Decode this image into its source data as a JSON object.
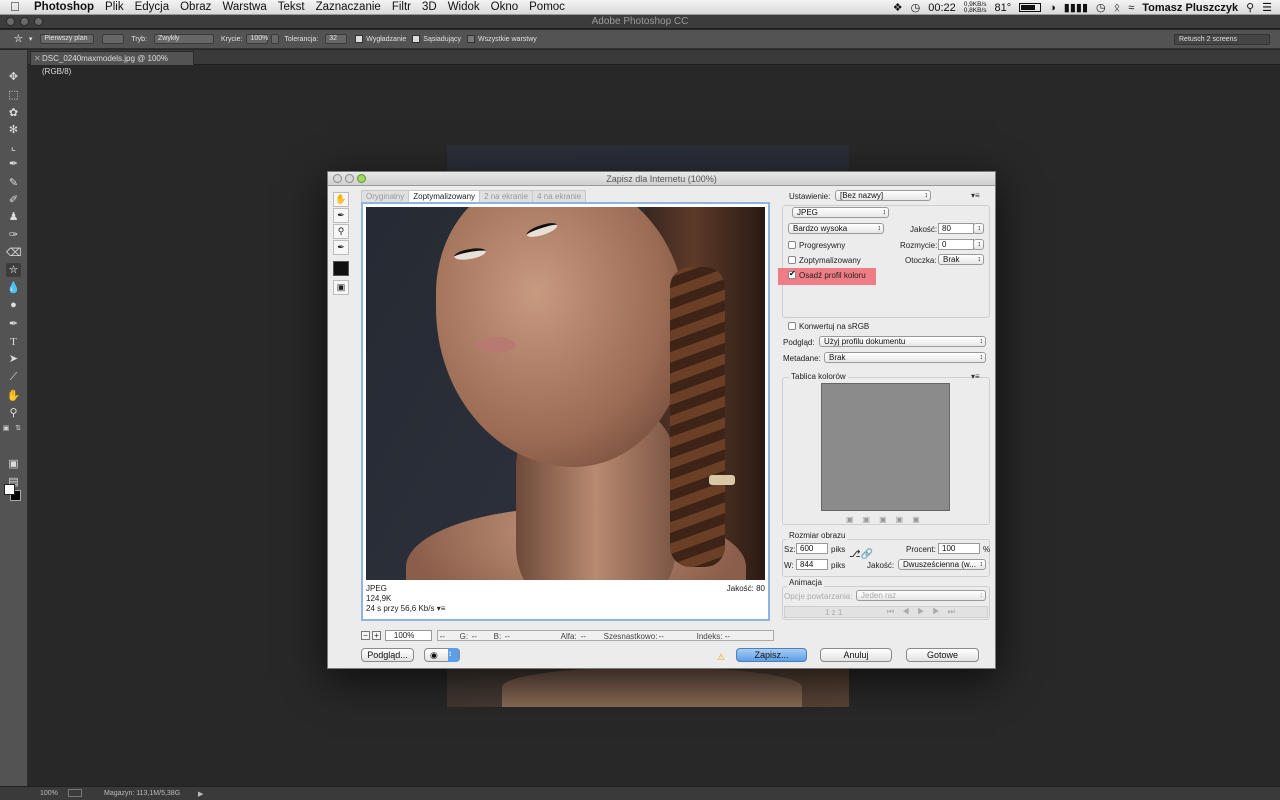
{
  "menubar": {
    "items": [
      "Photoshop",
      "Plik",
      "Edycja",
      "Obraz",
      "Warstwa",
      "Tekst",
      "Zaznaczanie",
      "Filtr",
      "3D",
      "Widok",
      "Okno",
      "Pomoc"
    ],
    "clock": "00:22",
    "net_up": "0,9KB/s",
    "net_down": "0,8KB/s",
    "temp": "81°",
    "user": "Tomasz Pluszczyk"
  },
  "app": {
    "title": "Adobe Photoshop CC"
  },
  "options_bar": {
    "mode_select": "Pierwszy plan",
    "mode_label": "Tryb:",
    "mode_value": "Zwykły",
    "opacity_label": "Krycie:",
    "opacity_value": "100%",
    "tolerance_label": "Tolerancja:",
    "tolerance_value": "32",
    "antialias": "Wygładzanie",
    "contiguous": "Sąsiadujący",
    "all_layers": "Wszystkie warstwy",
    "workspace": "Retusch 2 screens"
  },
  "document": {
    "tab": "DSC_0240maxmodels.jpg @ 100% (RGB/8)"
  },
  "statusbar": {
    "zoom": "100%",
    "memory": "Magazyn: 113,1M/5,38G"
  },
  "dialog": {
    "title": "Zapisz dla Internetu (100%)",
    "tabs": [
      "Oryginalny",
      "Zoptymalizowany",
      "2 na ekranie",
      "4 na ekranie"
    ],
    "preview": {
      "format": "JPEG",
      "size": "124,9K",
      "time": "24 s przy 56,6 Kb/s",
      "quality": "Jakość: 80"
    },
    "bottom": {
      "zoom": "100%",
      "r": "--",
      "g_label": "G:",
      "g": "--",
      "b_label": "B:",
      "b": "--",
      "alpha_label": "Alfa:",
      "alpha": "--",
      "hex_label": "Szesnastkowo:",
      "hex": "--",
      "index_label": "Indeks:",
      "index": "--"
    },
    "buttons": {
      "preview": "Podgląd...",
      "save": "Zapisz...",
      "cancel": "Anuluj",
      "done": "Gotowe"
    },
    "settings": {
      "preset_label": "Ustawienie:",
      "preset_value": "[Bez nazwy]",
      "format": "JPEG",
      "quality_preset": "Bardzo wysoka",
      "quality_label": "Jakość:",
      "quality_value": "80",
      "blur_label": "Rozmycie:",
      "blur_value": "0",
      "matte_label": "Otoczka:",
      "matte_value": "Brak",
      "progressive": "Progresywny",
      "optimized": "Zoptymalizowany",
      "embed_profile": "Osadź profil koloru",
      "convert_srgb": "Konwertuj na sRGB",
      "preview_label": "Podgląd:",
      "preview_value": "Użyj profilu dokumentu",
      "metadata_label": "Metadane:",
      "metadata_value": "Brak"
    },
    "color_table": {
      "title": "Tablica kolorów"
    },
    "image_size": {
      "title": "Rozmiar obrazu",
      "w_label": "Sz:",
      "w_value": "600",
      "h_label": "W:",
      "h_value": "844",
      "unit": "piks",
      "percent_label": "Procent:",
      "percent_value": "100",
      "percent_unit": "%",
      "quality_label": "Jakość:",
      "quality_value": "Dwusześcienna (w..."
    },
    "animation": {
      "title": "Animacja",
      "loop_label": "Opcje powtarzania:",
      "loop_value": "Jeden raz",
      "frame": "1 z 1"
    }
  }
}
